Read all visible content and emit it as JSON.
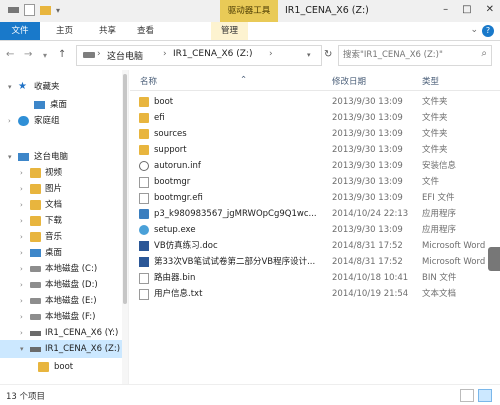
{
  "title": "IR1_CENA_X6 (Z:)",
  "context_tab": "驱动器工具",
  "window_controls": {
    "minimize": "–",
    "maximize": "□",
    "close": "✕"
  },
  "tabs": {
    "file": "文件",
    "home": "主页",
    "share": "共享",
    "view": "查看",
    "manage": "管理"
  },
  "help_label": "?",
  "address": {
    "crumbs": [
      "这台电脑",
      "IR1_CENA_X6 (Z:)"
    ],
    "separator": "›",
    "search_placeholder": "搜索\"IR1_CENA_X6 (Z:)\""
  },
  "columns": {
    "name": "名称",
    "date": "修改日期",
    "type": "类型"
  },
  "nav": {
    "favorites": "收藏夹",
    "desktop": "桌面",
    "homegroup": "家庭组",
    "thispc": "这台电脑",
    "pc_items": [
      "视频",
      "图片",
      "文档",
      "下载",
      "音乐",
      "桌面"
    ],
    "drives": [
      "本地磁盘 (C:)",
      "本地磁盘 (D:)",
      "本地磁盘 (E:)",
      "本地磁盘 (F:)",
      "IR1_CENA_X6 (Y:)",
      "IR1_CENA_X6 (Z:)"
    ],
    "subfolder": "boot"
  },
  "files": [
    {
      "name": "boot",
      "date": "2013/9/30 13:09",
      "type": "文件夹",
      "icon": "folder-icon"
    },
    {
      "name": "efi",
      "date": "2013/9/30 13:09",
      "type": "文件夹",
      "icon": "folder-icon"
    },
    {
      "name": "sources",
      "date": "2013/9/30 13:09",
      "type": "文件夹",
      "icon": "folder-icon"
    },
    {
      "name": "support",
      "date": "2013/9/30 13:09",
      "type": "文件夹",
      "icon": "folder-icon"
    },
    {
      "name": "autorun.inf",
      "date": "2013/9/30 13:09",
      "type": "安装信息",
      "icon": "settings-file-icon"
    },
    {
      "name": "bootmgr",
      "date": "2013/9/30 13:09",
      "type": "文件",
      "icon": "file-icon"
    },
    {
      "name": "bootmgr.efi",
      "date": "2013/9/30 13:09",
      "type": "EFI 文件",
      "icon": "file-icon"
    },
    {
      "name": "p3_k980983567_jgMRWOpCg9Q1wc...",
      "date": "2014/10/24 22:13",
      "type": "应用程序",
      "icon": "application-icon"
    },
    {
      "name": "setup.exe",
      "date": "2013/9/30 13:09",
      "type": "应用程序",
      "icon": "setup-icon"
    },
    {
      "name": "VB仿真练习.doc",
      "date": "2014/8/31 17:52",
      "type": "Microsoft Word",
      "icon": "word-doc-icon"
    },
    {
      "name": "第33次VB笔试试卷第二部分VB程序设计...",
      "date": "2014/8/31 17:52",
      "type": "Microsoft Word",
      "icon": "word-doc-icon"
    },
    {
      "name": "路由器.bin",
      "date": "2014/10/18 10:41",
      "type": "BIN 文件",
      "icon": "file-icon"
    },
    {
      "name": "用户信息.txt",
      "date": "2014/10/19 21:54",
      "type": "文本文档",
      "icon": "text-file-icon"
    }
  ],
  "status": {
    "count": "13 个项目"
  }
}
